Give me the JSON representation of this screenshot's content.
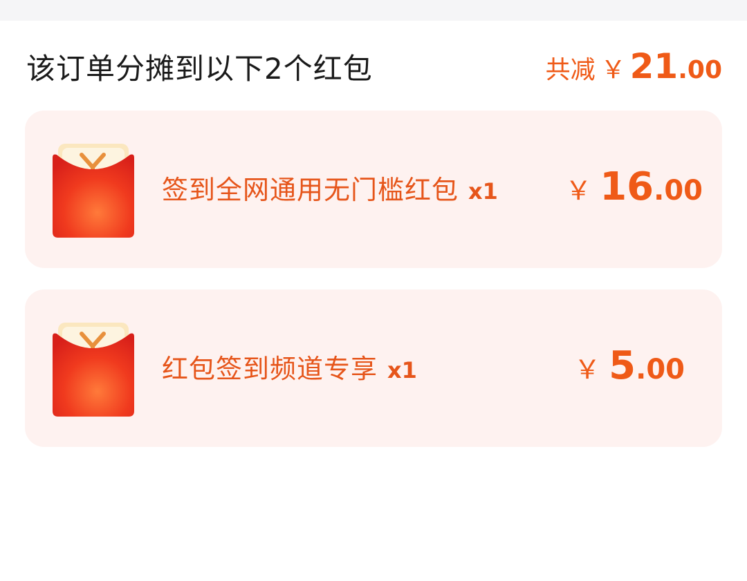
{
  "header": {
    "title": "该订单分摊到以下2个红包",
    "total_label": "共减",
    "currency_symbol": "￥",
    "total_int": "21",
    "total_dec": ".00"
  },
  "coupons": [
    {
      "name": "签到全网通用无门槛红包",
      "qty": "x1",
      "currency_symbol": "￥",
      "amount_int": "16",
      "amount_dec": ".00",
      "icon": "red-envelope-icon"
    },
    {
      "name": "红包签到频道专享",
      "qty": "x1",
      "currency_symbol": "￥",
      "amount_int": "5",
      "amount_dec": ".00",
      "icon": "red-envelope-icon"
    }
  ],
  "colors": {
    "accent": "#ef5a17",
    "card_background": "#fef2f0",
    "title_text": "#1a1a1a",
    "envelope_red": "#e8321c",
    "envelope_card": "#fdf2d6"
  }
}
